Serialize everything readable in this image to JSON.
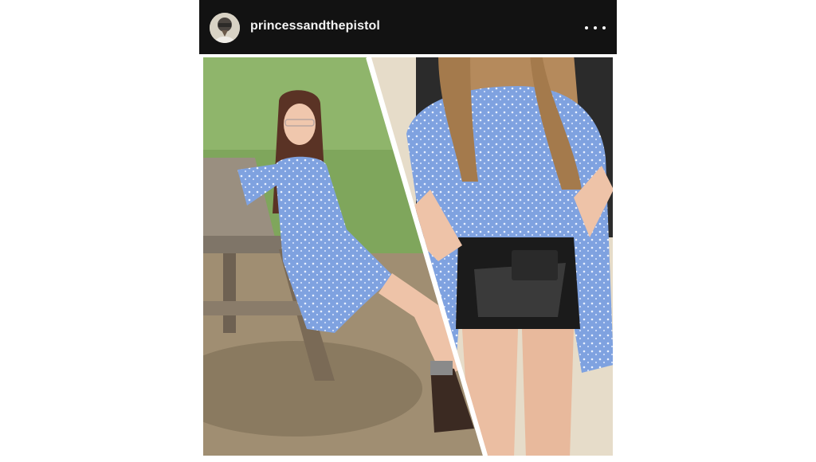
{
  "post": {
    "username": "princessandthepistol",
    "avatar_icon": "profile-avatar",
    "more_icon": "more-options-icon"
  },
  "colors": {
    "header_bg": "#121212",
    "dress": "#7fa2e0",
    "grass": "#7fa65c"
  }
}
